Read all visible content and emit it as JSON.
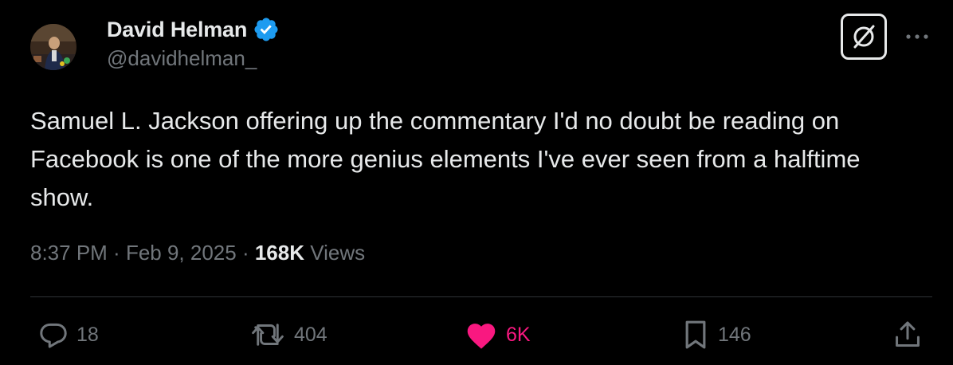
{
  "author": {
    "display_name": "David Helman",
    "handle": "@davidhelman_",
    "verified": true,
    "verified_color": "#1d9bf0"
  },
  "header_actions": {
    "grok_icon": "grok-icon",
    "more_icon": "more-icon"
  },
  "tweet": {
    "text": "Samuel L. Jackson offering up the commentary I'd no doubt be reading on Facebook is one of the more genius elements I've ever seen from a halftime show."
  },
  "meta": {
    "time": "8:37 PM",
    "separator": " · ",
    "date": "Feb 9, 2025",
    "views_count": "168K",
    "views_label": " Views"
  },
  "actions": {
    "replies": {
      "icon": "reply-icon",
      "count": "18"
    },
    "reposts": {
      "icon": "repost-icon",
      "count": "404"
    },
    "likes": {
      "icon": "heart-icon",
      "count": "6K",
      "liked": true,
      "color": "#f91880"
    },
    "bookmarks": {
      "icon": "bookmark-icon",
      "count": "146"
    },
    "share": {
      "icon": "share-icon"
    }
  },
  "colors": {
    "background": "#000000",
    "primary_text": "#e7e9ea",
    "secondary_text": "#71767b",
    "divider": "#2f3336"
  }
}
